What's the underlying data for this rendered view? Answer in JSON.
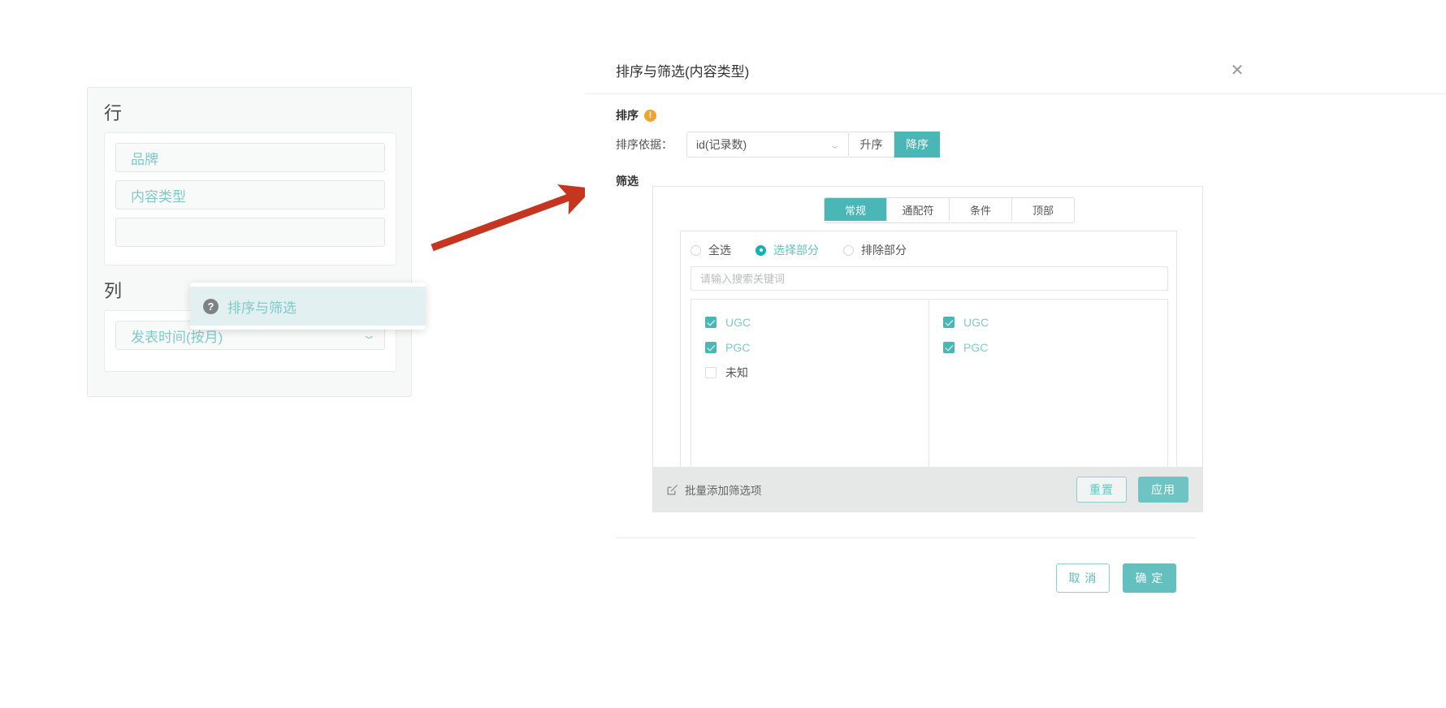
{
  "shelf": {
    "rows_title": "行",
    "cols_title": "列",
    "row_pills": [
      {
        "label": "品牌"
      },
      {
        "label": "内容类型"
      },
      {
        "label": ""
      }
    ],
    "col_pills": [
      {
        "label": "发表时间(按月)",
        "caret": "⌄"
      }
    ],
    "flyout": {
      "icon": "?",
      "label": "排序与筛选"
    }
  },
  "dialog": {
    "title": "排序与筛选(内容类型)",
    "close_icon": "✕",
    "sort": {
      "section_label": "排序",
      "warning_icon": "!",
      "sort_by_label": "排序依据：",
      "field_value": "id(记录数)",
      "field_caret": "⌄",
      "ascending_label": "升序",
      "descending_label": "降序",
      "active_direction": "降序"
    },
    "filter": {
      "section_label": "筛选",
      "tabs": [
        {
          "label": "常规",
          "active": true
        },
        {
          "label": "通配符",
          "active": false
        },
        {
          "label": "条件",
          "active": false
        },
        {
          "label": "顶部",
          "active": false
        }
      ],
      "scope_options": [
        {
          "label": "全选",
          "selected": false
        },
        {
          "label": "选择部分",
          "selected": true
        },
        {
          "label": "排除部分",
          "selected": false
        }
      ],
      "search_placeholder": "请输入搜索关键词",
      "search_value": "",
      "available_items": [
        {
          "label": "UGC",
          "checked": true
        },
        {
          "label": "PGC",
          "checked": true
        },
        {
          "label": "未知",
          "checked": false
        }
      ],
      "selected_items": [
        {
          "label": "UGC",
          "checked": true
        },
        {
          "label": "PGC",
          "checked": true
        }
      ],
      "bulk_add_label": "批量添加筛选项",
      "reset_label": "重置",
      "apply_label": "应用"
    },
    "footer": {
      "cancel_label": "取 消",
      "confirm_label": "确 定"
    }
  },
  "annotation": {
    "arrow_color": "#c5351f"
  },
  "colors": {
    "accent": "#4ab7b6",
    "accent_light": "#7ecbc9",
    "warning": "#f0a32e",
    "highlight_bg": "#e2f0f2",
    "panel_bg": "#f7f8f8",
    "footer_bg": "#e6e7e7"
  }
}
